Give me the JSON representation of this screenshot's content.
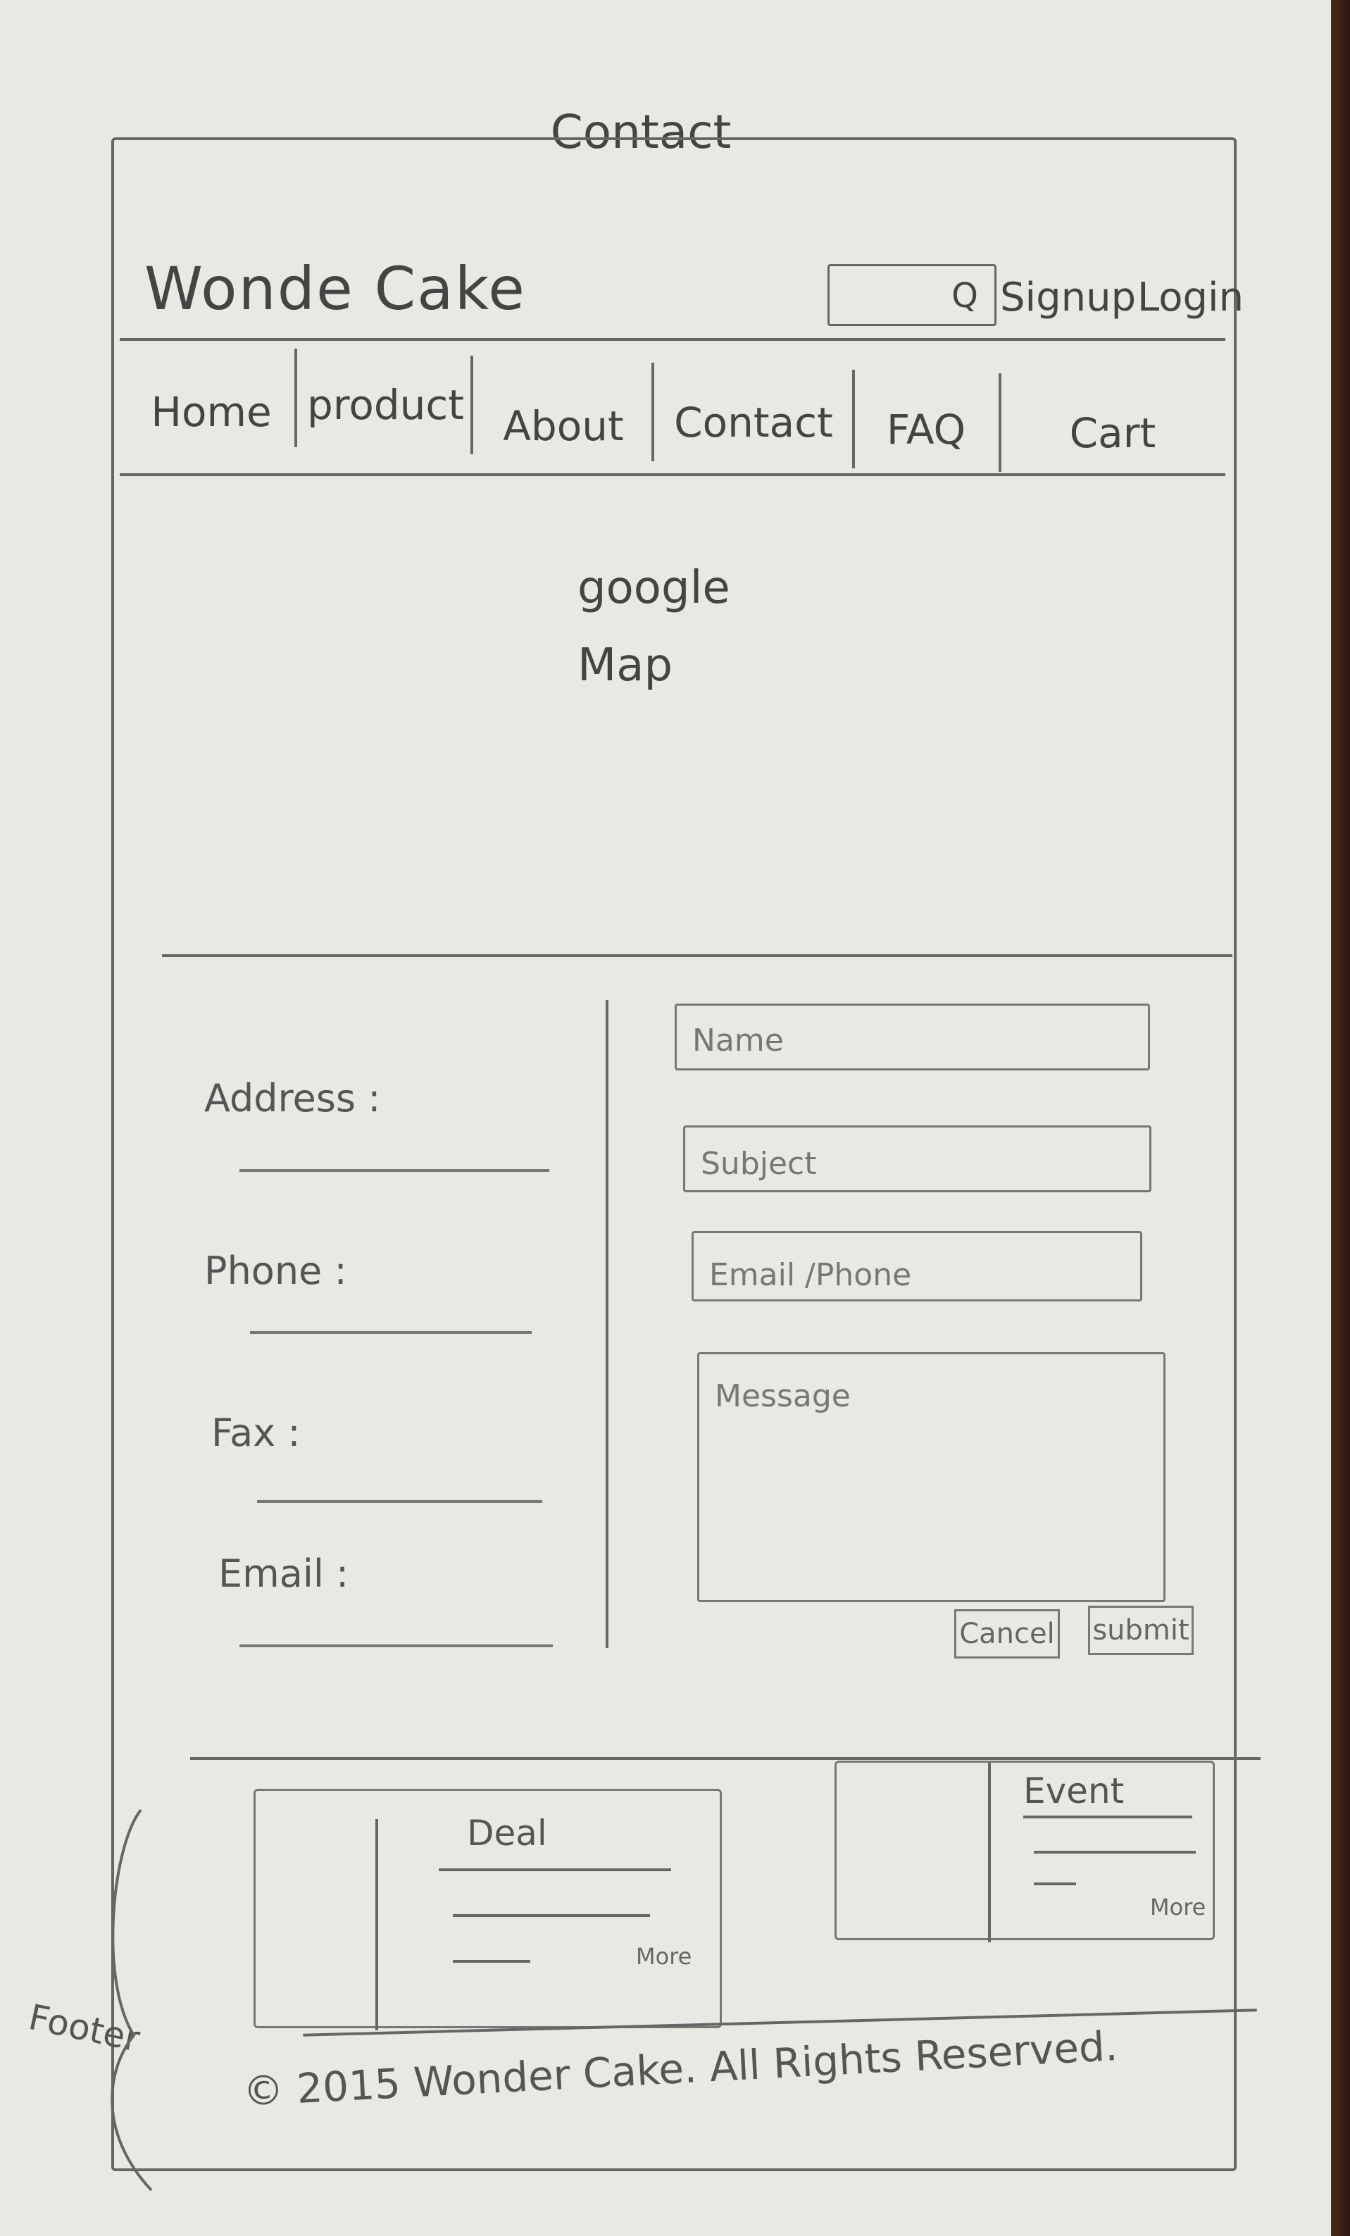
{
  "page_title": "Contact",
  "header": {
    "brand": "Wonde Cake",
    "search_icon_glyph": "Q",
    "signup": "Signup",
    "login": "Login"
  },
  "nav": {
    "items": [
      "Home",
      "product",
      "About",
      "Contact",
      "FAQ",
      "Cart"
    ]
  },
  "map": {
    "line1": "google",
    "line2": "Map"
  },
  "contact_info": {
    "address_label": "Address :",
    "phone_label": "Phone :",
    "fax_label": "Fax :",
    "email_label": "Email :"
  },
  "form": {
    "name_placeholder": "Name",
    "subject_placeholder": "Subject",
    "email_phone_placeholder": "Email /Phone",
    "message_placeholder": "Message",
    "cancel_label": "Cancel",
    "submit_label": "submit"
  },
  "footer": {
    "deal_title": "Deal",
    "deal_more": "More",
    "event_title": "Event",
    "event_more": "More",
    "copyright": "© 2015 Wonder Cake. All Rights Reserved.",
    "annotation": "Footer"
  }
}
